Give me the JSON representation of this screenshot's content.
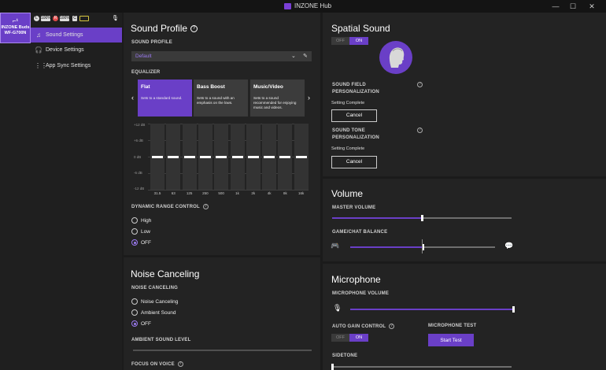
{
  "titlebar": {
    "title": "INZONE Hub",
    "min": "—",
    "max": "☐",
    "close": "✕"
  },
  "device": {
    "glyph": "⌐¹",
    "name_line1": "INZONE Buds",
    "name_line2": "WF-G700N"
  },
  "status": {
    "b1": "L",
    "b2": "100%",
    "b3": "R",
    "b4": "100%",
    "b5": "C"
  },
  "sidebar": {
    "items": [
      {
        "label": "Sound Settings",
        "icon": "music-note-icon"
      },
      {
        "label": "Device Settings",
        "icon": "headphones-icon"
      },
      {
        "label": "App Sync Settings",
        "icon": "grid-icon"
      }
    ]
  },
  "sound_profile": {
    "title": "Sound Profile",
    "profile_label": "SOUND PROFILE",
    "profile_value": "Default",
    "equalizer_label": "EQUALIZER",
    "presets": [
      {
        "name": "Flat",
        "desc": "Sets to a standard sound."
      },
      {
        "name": "Bass Boost",
        "desc": "Sets to a sound with an emphasis on the lows."
      },
      {
        "name": "Music/Video",
        "desc": "Sets to a sound recommended for enjoying music and videos."
      }
    ],
    "db_ticks": [
      "+12 dB",
      "+6 dB",
      "0 dB",
      "-6 dB",
      "-12 dB"
    ],
    "bands": [
      {
        "freq": "31.5",
        "gain": 0
      },
      {
        "freq": "63",
        "gain": 0
      },
      {
        "freq": "125",
        "gain": 0
      },
      {
        "freq": "250",
        "gain": 0
      },
      {
        "freq": "500",
        "gain": 0
      },
      {
        "freq": "1k",
        "gain": 0
      },
      {
        "freq": "2k",
        "gain": 0
      },
      {
        "freq": "4k",
        "gain": 0
      },
      {
        "freq": "8k",
        "gain": 0
      },
      {
        "freq": "16k",
        "gain": 0
      }
    ],
    "drc_label": "DYNAMIC RANGE CONTROL",
    "drc_options": [
      "High",
      "Low",
      "OFF"
    ],
    "drc_selected": "OFF"
  },
  "noise": {
    "title": "Noise Canceling",
    "label": "NOISE CANCELING",
    "options": [
      "Noise Canceling",
      "Ambient Sound",
      "OFF"
    ],
    "selected": "OFF",
    "ambient_label": "AMBIENT SOUND LEVEL",
    "focus_label": "FOCUS ON VOICE"
  },
  "spatial": {
    "title": "Spatial Sound",
    "toggle_off": "OFF",
    "toggle_on": "ON",
    "sf_line1": "SOUND FIELD",
    "sf_line2": "PERSONALIZATION",
    "sf_status": "Setting Complete",
    "sf_button": "Cancel",
    "st_line1": "SOUND TONE",
    "st_line2": "PERSONALIZATION",
    "st_status": "Setting Complete",
    "st_button": "Cancel"
  },
  "volume": {
    "title": "Volume",
    "master_label": "MASTER VOLUME",
    "master_level": 0.5,
    "balance_label": "GAME/CHAT BALANCE",
    "balance_level": 0.5
  },
  "microphone": {
    "title": "Microphone",
    "volume_label": "MICROPHONE VOLUME",
    "volume_level": 1.0,
    "agc_label": "AUTO GAIN CONTROL",
    "agc_off": "OFF",
    "agc_on": "ON",
    "test_label": "MICROPHONE TEST",
    "test_button": "Start Test",
    "sidetone_label": "SIDETONE",
    "sidetone_level": 0.0
  },
  "colors": {
    "accent": "#6a3fc7",
    "background": "#1b1b1b",
    "panel": "#232323"
  }
}
